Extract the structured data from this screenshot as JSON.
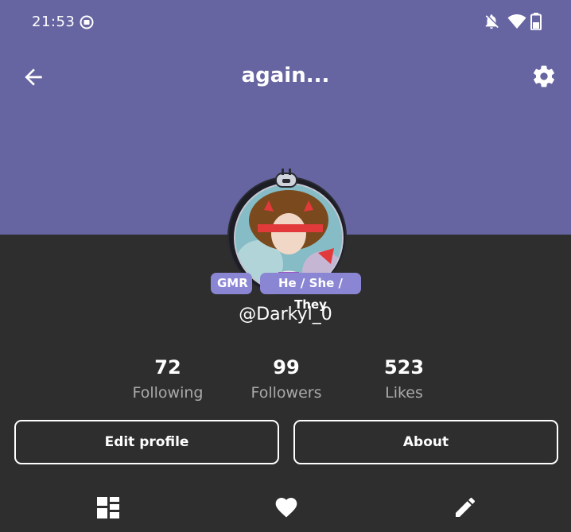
{
  "status_bar": {
    "time": "21:53",
    "icons": [
      "media-indicator-icon",
      "bell-off-icon",
      "wifi-icon",
      "battery-icon"
    ]
  },
  "app_bar": {
    "title": "again...",
    "back_icon": "arrow-left-icon",
    "settings_icon": "gear-icon"
  },
  "profile": {
    "badges": [
      "GMR",
      "He / She / They"
    ],
    "username": "@Darkyl_0",
    "stats": [
      {
        "value": "72",
        "label": "Following"
      },
      {
        "value": "99",
        "label": "Followers"
      },
      {
        "value": "523",
        "label": "Likes"
      }
    ]
  },
  "actions": {
    "edit_profile": "Edit profile",
    "about": "About"
  },
  "tabs": [
    "grid-icon",
    "heart-icon",
    "pencil-icon"
  ],
  "colors": {
    "header": "#6665a1",
    "background": "#2e2e2e",
    "badge": "#8a86d4",
    "muted_text": "#a9a9a9"
  }
}
